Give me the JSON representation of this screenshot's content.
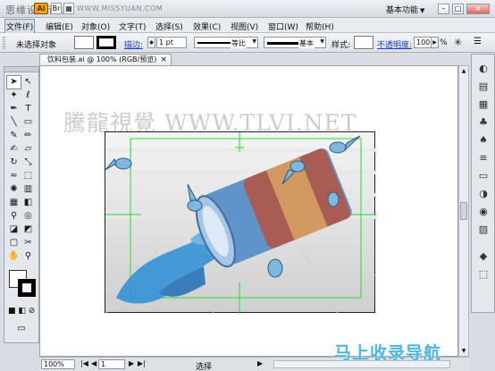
{
  "watermarks": {
    "top": "思缘设计论坛",
    "url": "WWW.MISSYUAN.COM",
    "mid": "騰龍視覺 WWW.TLVI.NET",
    "bottom": "马上收录导航"
  },
  "titlebar": {
    "app_icon": "Ai",
    "btn_a": "Br",
    "btn_b": "▦",
    "workspace": "基本功能",
    "workspace_arrow": "▼",
    "min": "–",
    "max": "□",
    "close": "×"
  },
  "menubar": {
    "items": [
      {
        "label": "文件(F)"
      },
      {
        "label": "编辑(E)"
      },
      {
        "label": "对象(O)"
      },
      {
        "label": "文字(T)"
      },
      {
        "label": "选择(S)"
      },
      {
        "label": "效果(C)"
      },
      {
        "label": "视图(V)"
      },
      {
        "label": "窗口(W)"
      },
      {
        "label": "帮助(H)"
      }
    ]
  },
  "controlbar": {
    "selection": "未选择对象",
    "stroke_label": "描边:",
    "stroke_weight": "1 pt",
    "profile_label": "等比",
    "brush_label": "基本",
    "style_label": "样式:",
    "opacity_label": "不透明度:",
    "opacity_value": "100",
    "percent": "%"
  },
  "document": {
    "tab_title": "饮料包装.ai @ 100% (RGB/预览)",
    "tab_close": "×"
  },
  "statusbar": {
    "zoom": "100%",
    "page": "1",
    "status": "选择",
    "nav_first": "|◀",
    "nav_prev": "◀",
    "nav_next": "▶",
    "nav_last": "▶|",
    "status_arrow": "▶"
  },
  "icons": {
    "tools": [
      "selection-tool-icon",
      "direct-selection-tool-icon",
      "magic-wand-tool-icon",
      "lasso-tool-icon",
      "pen-tool-icon",
      "type-tool-icon",
      "line-tool-icon",
      "rectangle-tool-icon",
      "paintbrush-tool-icon",
      "pencil-tool-icon",
      "blob-brush-tool-icon",
      "eraser-tool-icon",
      "rotate-tool-icon",
      "scale-tool-icon",
      "warp-tool-icon",
      "free-transform-tool-icon",
      "symbol-sprayer-tool-icon",
      "column-graph-tool-icon",
      "mesh-tool-icon",
      "gradient-tool-icon",
      "eyedropper-tool-icon",
      "blend-tool-icon",
      "live-paint-tool-icon",
      "live-paint-selection-tool-icon",
      "artboard-tool-icon",
      "slice-tool-icon",
      "hand-tool-icon",
      "zoom-tool-icon"
    ],
    "right_panel": [
      "color-panel-icon",
      "color-guide-icon",
      "swatches-icon",
      "brushes-icon",
      "symbols-icon",
      "stroke-icon",
      "gradient-icon",
      "transparency-icon",
      "appearance-icon",
      "graphic-styles-icon",
      "layers-icon",
      "artboards-icon"
    ]
  },
  "colors": {
    "canvas_bg": "#ffffff",
    "guide_green": "#22dd33",
    "can_blue": "#5f93c9",
    "water_blue": "#2c8fd6"
  }
}
